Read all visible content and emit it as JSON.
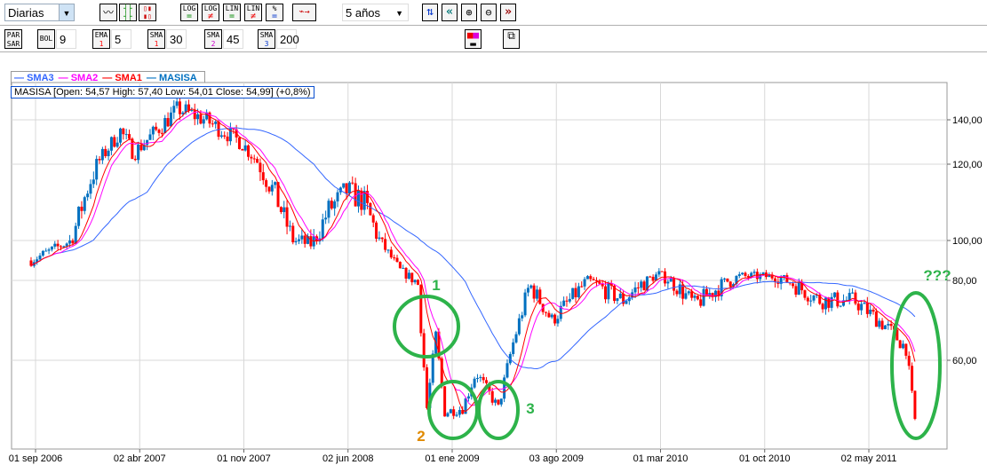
{
  "toolbar": {
    "period": "Diarias",
    "range": "5 años",
    "scale_buttons": [
      [
        "LOG",
        "="
      ],
      [
        "LOG",
        "≠"
      ],
      [
        "LIN",
        "="
      ],
      [
        "LIN",
        "≠"
      ],
      [
        "%",
        "="
      ]
    ]
  },
  "indicators": {
    "parsar": [
      "PAR",
      "SAR"
    ],
    "bol": {
      "label": "BOL",
      "value": "9"
    },
    "ema": {
      "label": "EMA",
      "sub": "1",
      "value": "5"
    },
    "sma1": {
      "label": "SMA",
      "sub": "1",
      "value": "30"
    },
    "sma2": {
      "label": "SMA",
      "sub": "2",
      "value": "45"
    },
    "sma3": {
      "label": "SMA",
      "sub": "3",
      "value": "200"
    }
  },
  "legend": [
    {
      "name": "SMA3",
      "color": "#3366ff"
    },
    {
      "name": "SMA2",
      "color": "#ff00ff"
    },
    {
      "name": "SMA1",
      "color": "#ff0000"
    },
    {
      "name": "MASISA",
      "color": "#0070c0"
    }
  ],
  "info": "MASISA [Open: 54,57  High: 57,40  Low: 54,01  Close: 54,99] (+0,8%)",
  "chart_data": {
    "type": "candlestick",
    "title": "MASISA",
    "x_tick_labels": [
      "01 sep 2006",
      "02 abr 2007",
      "01 nov 2007",
      "02 jun 2008",
      "01 ene 2009",
      "03 ago 2009",
      "01 mar 2010",
      "01 oct 2010",
      "02 may 2011"
    ],
    "x_tick_months": [
      0,
      7,
      14,
      21,
      28,
      35,
      42,
      49,
      56
    ],
    "y_ticks": [
      140,
      120,
      100,
      80,
      60
    ],
    "y_tick_labels": [
      "140,00",
      "120,00",
      "100,00",
      "80,00",
      "60,00"
    ],
    "close_path_months": [
      -0.3,
      2.4,
      3.6,
      5.7,
      6.6,
      9.6,
      11.4,
      13.8,
      16.1,
      17.3,
      18.5,
      19.7,
      20.9,
      22.1,
      23.3,
      24.5,
      25.7,
      26.3,
      26.9,
      27.5,
      28.7,
      29.6,
      31.1,
      32.0,
      33.2,
      34.7,
      37.1,
      39.5,
      41.9,
      44.3,
      47.3,
      49.7,
      52.7,
      55.0,
      57.3,
      58.5,
      59.1,
      59.3
    ],
    "close_path_prices": [
      90,
      100,
      115,
      135,
      125,
      145,
      140,
      130,
      112,
      100,
      98,
      108,
      113,
      110,
      98,
      85,
      79,
      48,
      66,
      47,
      48,
      57,
      48,
      63,
      79,
      70,
      80,
      75,
      83,
      74,
      82,
      82,
      75,
      75,
      68,
      63,
      45,
      55
    ],
    "annotations": [
      {
        "text": "1",
        "color": "#2db34a"
      },
      {
        "text": "2",
        "color": "#e08a00"
      },
      {
        "text": "3",
        "color": "#2db34a"
      },
      {
        "text": "???",
        "color": "#2db34a"
      }
    ],
    "up_color": "#0070c0",
    "down_color": "#ff0000"
  }
}
